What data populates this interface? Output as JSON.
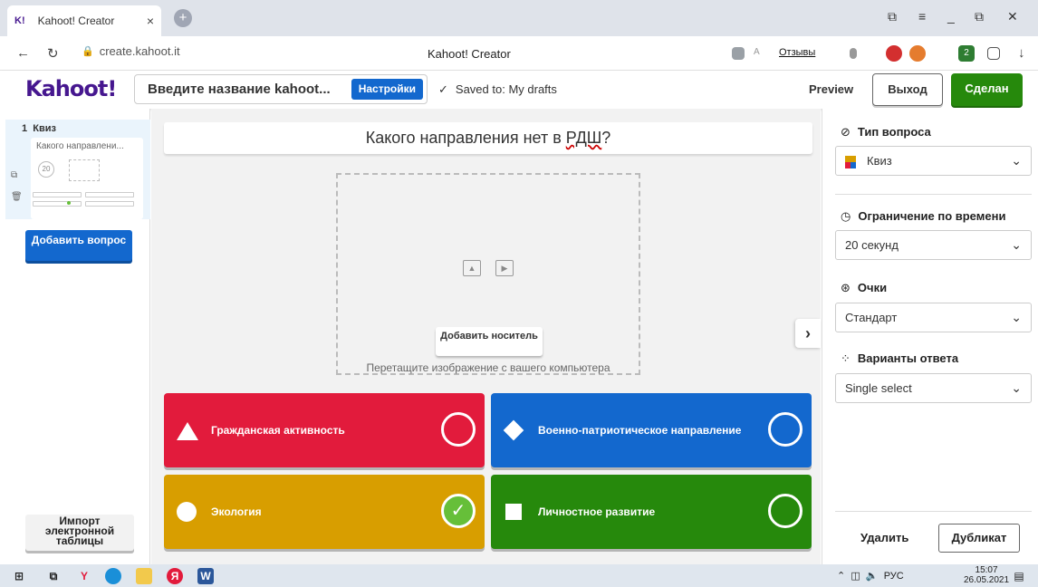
{
  "browser": {
    "tab_logo": "K!",
    "tab_title": "Kahoot! Creator",
    "tab_close": "×",
    "new_tab": "+",
    "url": "create.kahoot.it",
    "page_title": "Kahoot! Creator",
    "feedback_label": "Отзывы",
    "extension_badge": "2"
  },
  "header": {
    "logo": "Kahoot!",
    "title_placeholder": "Введите название kahoot...",
    "settings_label": "Настройки",
    "saved_status": "Saved to: My drafts",
    "preview_label": "Preview",
    "exit_label": "Выход",
    "done_label": "Сделан"
  },
  "sidebar": {
    "slide_number": "1",
    "slide_type": "Квиз",
    "slide_question": "Какого направлени...",
    "slide_timer": "20",
    "add_question_label": "Добавить вопрос",
    "import_label": "Импорт электронной таблицы"
  },
  "editor": {
    "question_prefix": "Какого направления нет в ",
    "question_underlined": "РДШ",
    "question_suffix": "?",
    "add_media_label": "Добавить носитель",
    "drag_hint": "Перетащите изображение с вашего компьютера",
    "answers": [
      {
        "text": "Гражданская активность",
        "shape": "triangle",
        "color": "#e21b3c",
        "correct": false
      },
      {
        "text": "Военно-патриотическое направление",
        "shape": "diamond",
        "color": "#1368ce",
        "correct": false
      },
      {
        "text": "Экология",
        "shape": "circle",
        "color": "#d89e00",
        "correct": true
      },
      {
        "text": "Личностное развитие",
        "shape": "square",
        "color": "#26890c",
        "correct": false
      }
    ]
  },
  "settings_panel": {
    "question_type_label": "Тип вопроса",
    "question_type_value": "Квиз",
    "time_limit_label": "Ограничение по времени",
    "time_limit_value": "20 секунд",
    "points_label": "Очки",
    "points_value": "Стандарт",
    "answer_options_label": "Варианты ответа",
    "answer_options_value": "Single select",
    "delete_label": "Удалить",
    "duplicate_label": "Дубликат"
  },
  "taskbar": {
    "language": "РУС",
    "time": "15:07",
    "date": "26.05.2021"
  },
  "colors": {
    "kahoot_purple": "#46178f",
    "primary_blue": "#1368ce",
    "done_green": "#26890c",
    "correct_green": "#66bf39"
  }
}
